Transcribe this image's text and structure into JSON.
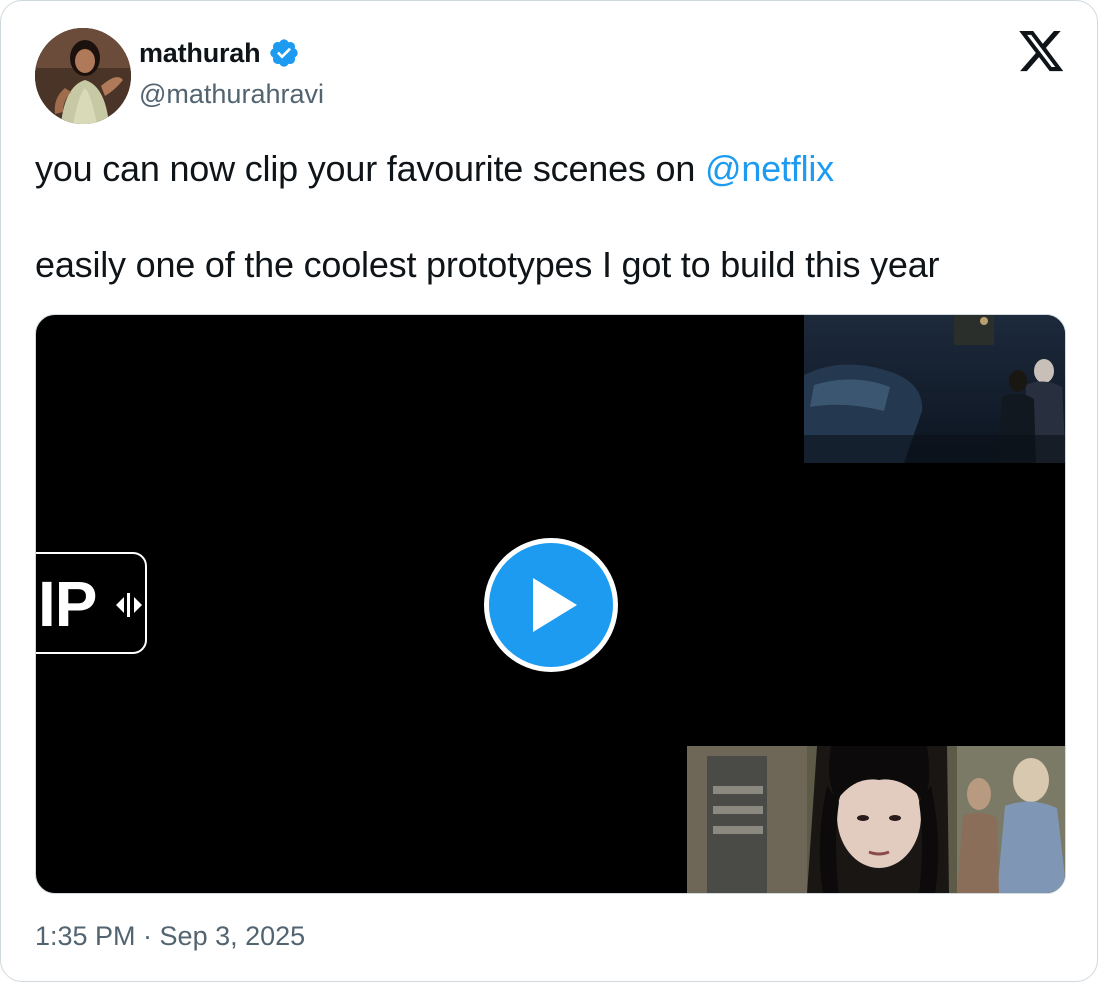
{
  "author": {
    "display_name": "mathurah",
    "handle": "@mathurahravi",
    "verified": true,
    "avatar_icon": "profile-photo"
  },
  "brand": {
    "logo_icon": "x-logo-icon"
  },
  "tweet": {
    "text_line1_prefix": "you can now clip your favourite scenes on ",
    "mention": "@netflix",
    "text_line2": "easily one of the coolest prototypes I got to build this year",
    "timestamp": "1:35 PM · Sep 3, 2025"
  },
  "media": {
    "clip_label": "IP",
    "play_icon": "play-icon"
  },
  "colors": {
    "accent": "#1d9bf0",
    "text": "#0f1419",
    "secondary": "#536471",
    "border": "#cfd9de"
  }
}
